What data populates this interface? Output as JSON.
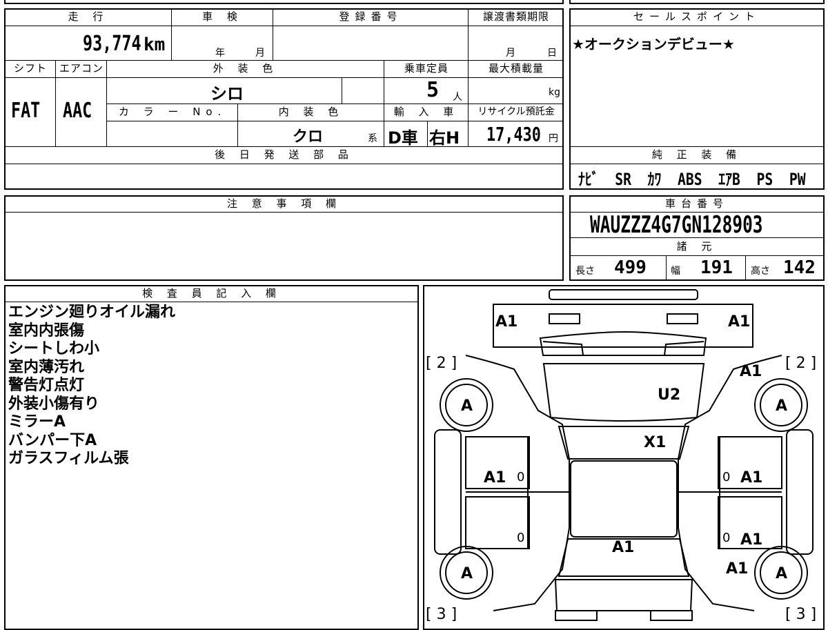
{
  "vehicle_info": {
    "mileage_label": "走 行",
    "mileage_value": "93,774",
    "mileage_unit": "km",
    "shaken_label": "車 検",
    "shaken_year_unit": "年",
    "shaken_month_unit": "月",
    "registration_label": "登録番号",
    "transfer_deadline_label": "譲渡書類期限",
    "transfer_month_unit": "月",
    "transfer_day_unit": "日",
    "shift_label": "シフト",
    "shift_value": "FAT",
    "aircon_label": "エアコン",
    "aircon_value": "AAC",
    "exterior_color_label": "外 装 色",
    "exterior_color_value": "シロ",
    "capacity_label": "乗車定員",
    "capacity_value": "5",
    "capacity_unit": "人",
    "max_load_label": "最大積載量",
    "max_load_unit": "kg",
    "color_no_label": "カ ラ ー No.",
    "interior_color_label": "内 装 色",
    "interior_color_value": "クロ",
    "interior_color_suffix": "系",
    "import_label": "輸 入 車",
    "import_type": "D車",
    "steering": "右H",
    "recycle_label": "リサイクル預託金",
    "recycle_value": "17,430",
    "recycle_unit": "円",
    "parts_label": "後 日 発 送 部 品"
  },
  "sales_point": {
    "label": "セールスポイント",
    "text": "★オークションデビュー★"
  },
  "equipment": {
    "label": "純 正 装 備",
    "items": [
      "ﾅﾋﾞ",
      "SR",
      "ｶﾜ",
      "ABS",
      "ｴｱB",
      "PS",
      "PW"
    ]
  },
  "notes": {
    "label": "注 意 事 項 欄"
  },
  "chassis": {
    "label": "車台番号",
    "value": "WAUZZZ4G7GN128903",
    "specs_label": "諸 元",
    "length_label": "長さ",
    "length_value": "499",
    "width_label": "幅",
    "width_value": "191",
    "height_label": "高さ",
    "height_value": "142"
  },
  "inspector": {
    "label": "検 査 員 記 入 欄",
    "lines": [
      "エンジン廻りオイル漏れ",
      "室内内張傷",
      "シートしわ小",
      "室内薄汚れ",
      "警告灯点灯",
      "外装小傷有り",
      "ミラーA",
      "バンパー下A",
      "ガラスフィルム張"
    ]
  },
  "diagram": {
    "front_left": "A1",
    "front_right": "A1",
    "front_right_fender": "A1",
    "hood": "U2",
    "windshield": "X1",
    "front_left_door": "A1",
    "front_right_door": "A1",
    "rear_right_door": "A1",
    "trunk": "A1",
    "rear_right_fender": "A1",
    "tire_fl": "A",
    "tire_fr": "A",
    "tire_rl": "A",
    "tire_rr": "A",
    "tread_front_left": "[ 2 ]",
    "tread_front_right": "[ 2 ]",
    "tread_rear_left": "[ 3 ]",
    "tread_rear_right": "[ 3 ]",
    "door_zero_1": "0",
    "door_zero_2": "0",
    "door_zero_3": "0",
    "door_zero_4": "0"
  }
}
